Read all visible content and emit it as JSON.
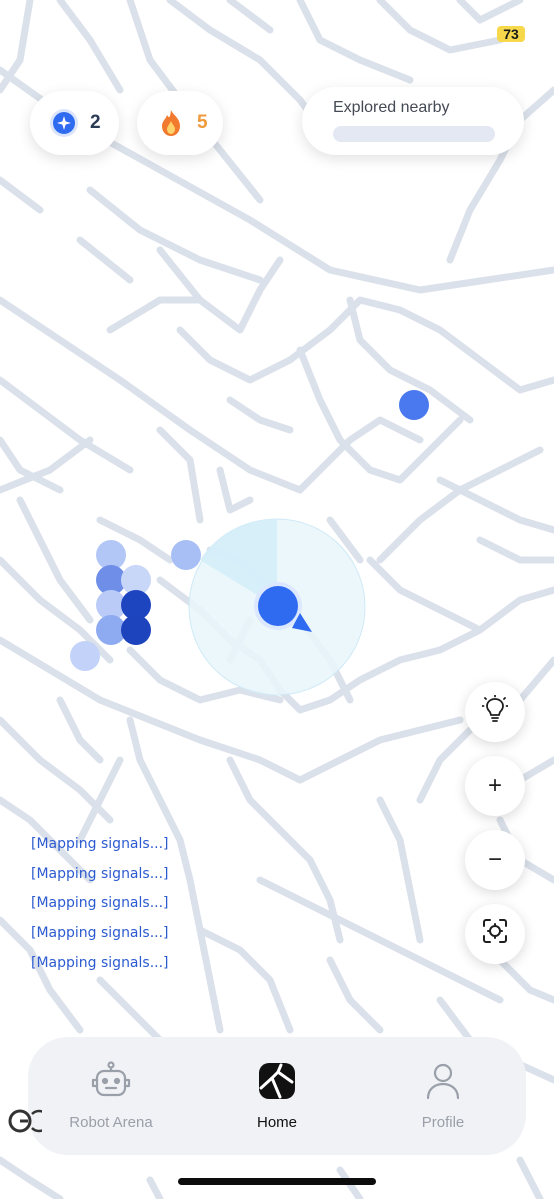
{
  "status_bar": {
    "battery_level": "73"
  },
  "stats": {
    "stars": {
      "icon": "star-badge-icon",
      "value": "2",
      "color": "#2b3a55"
    },
    "streak": {
      "icon": "flame-icon",
      "value": "5",
      "color": "#f09a3a"
    }
  },
  "explored": {
    "label": "Explored nearby",
    "progress_percent": 0
  },
  "map_controls": {
    "hint": {
      "icon": "lightbulb-icon"
    },
    "zoom_in": {
      "label": "+",
      "icon": "plus-icon"
    },
    "zoom_out": {
      "label": "−",
      "icon": "minus-icon"
    },
    "recenter": {
      "icon": "locate-icon"
    }
  },
  "log_lines": [
    "[Mapping signals...]",
    "[Mapping signals...]",
    "[Mapping signals...]",
    "[Mapping signals...]",
    "[Mapping signals...]"
  ],
  "nav": {
    "items": [
      {
        "label": "Robot Arena",
        "icon": "robot-icon",
        "active": false
      },
      {
        "label": "Home",
        "icon": "map-home-icon",
        "active": true
      },
      {
        "label": "Profile",
        "icon": "person-icon",
        "active": false
      }
    ]
  },
  "colors": {
    "accent": "#2f6bf0",
    "road": "#dde3eb",
    "inactive_nav": "#9aa0aa",
    "active_nav": "#111111",
    "log_text": "#2c5bd0"
  }
}
